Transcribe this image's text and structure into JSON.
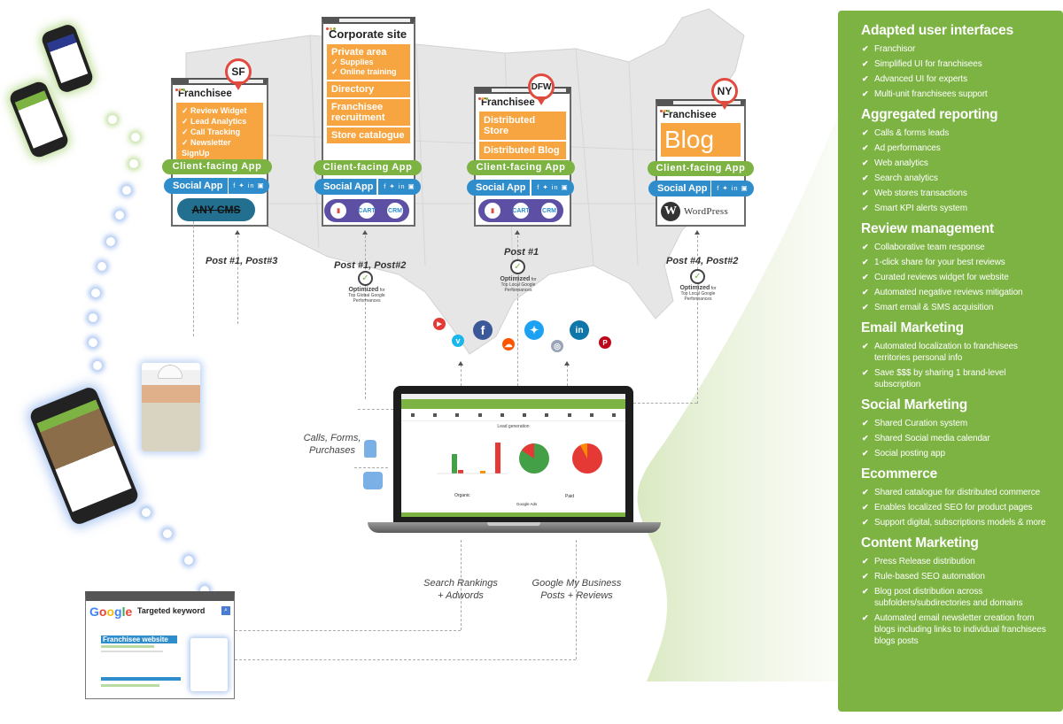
{
  "sites": {
    "sf": {
      "pin": "SF",
      "title": "Franchisee",
      "features": [
        "Review Widget",
        "Lead Analytics",
        "Call Tracking",
        "Newsletter SignUp"
      ],
      "client_app": "Client-facing App",
      "social_app": "Social App",
      "social_icons": "f ✦ in ▣",
      "cms": "ANY CMS",
      "posts": "Post #1, Post#3"
    },
    "corporate": {
      "title": "Corporate site",
      "private_area": "Private area",
      "private_items": [
        "Supplies",
        "Online training"
      ],
      "sections": [
        "Directory",
        "Franchisee recruitment",
        "Store catalogue"
      ],
      "client_app": "Client-facing App",
      "social_app": "Social App",
      "social_icons": "f ✦ in ▣",
      "apps": [
        "store-icon",
        "CART",
        "CRM"
      ],
      "posts": "Post #1, Post#2",
      "optimized": "Optimized",
      "optimized_for": "for",
      "optimized_desc": "Top Global Google Performances"
    },
    "dfw": {
      "pin": "DFW",
      "title": "Franchisee",
      "sections": [
        "Distributed Store",
        "Distributed Blog"
      ],
      "client_app": "Client-facing App",
      "social_app": "Social App",
      "social_icons": "f ✦ in ▣",
      "apps": [
        "store-icon",
        "CART",
        "CRM"
      ],
      "posts": "Post #1",
      "optimized": "Optimized",
      "optimized_for": "for",
      "optimized_desc": "Top Local Google Performances"
    },
    "ny": {
      "pin": "NY",
      "title": "Franchisee",
      "blog": "Blog",
      "client_app": "Client-facing App",
      "social_app": "Social App",
      "social_icons": "f ✦ in ▣",
      "cms": "WordPress",
      "posts": "Post #4, Post#2",
      "optimized": "Optimized",
      "optimized_for": "for",
      "optimized_desc": "Top Local Google Performances"
    }
  },
  "social_networks": [
    {
      "name": "youtube",
      "glyph": "▶",
      "color": "#e53935"
    },
    {
      "name": "vimeo",
      "glyph": "v",
      "color": "#1ab7ea"
    },
    {
      "name": "facebook",
      "glyph": "f",
      "color": "#3b5998"
    },
    {
      "name": "soundcloud",
      "glyph": "☁",
      "color": "#ff5500"
    },
    {
      "name": "twitter",
      "glyph": "✦",
      "color": "#1da1f2"
    },
    {
      "name": "instagram",
      "glyph": "◎",
      "color": "#9aa4b8"
    },
    {
      "name": "linkedin",
      "glyph": "in",
      "color": "#0e76a8"
    },
    {
      "name": "pinterest",
      "glyph": "P",
      "color": "#bd081c"
    }
  ],
  "flows": {
    "calls": "Calls, Forms, Purchases",
    "search": "Search Rankings + Adwords",
    "gmb": "Google My Business Posts + Reviews"
  },
  "dashboard": {
    "title": "Lead generation",
    "organic": "Organic",
    "paid": "Paid",
    "google_ads": "Google Ads"
  },
  "google_search": {
    "logo": "Google",
    "keyword": "Targeted keyword",
    "result": "Franchisee website"
  },
  "panel": {
    "sections": [
      {
        "title": "Adapted user interfaces",
        "items": [
          "Franchisor",
          "Simplified UI for franchisees",
          "Advanced UI for experts",
          "Multi-unit franchisees support"
        ]
      },
      {
        "title": "Aggregated reporting",
        "items": [
          "Calls & forms leads",
          "Ad performances",
          "Web analytics",
          "Search analytics",
          "Web stores transactions",
          "Smart KPI alerts system"
        ]
      },
      {
        "title": "Review management",
        "items": [
          "Collaborative team response",
          "1-click share for your best reviews",
          "Curated reviews widget for website",
          "Automated negative reviews mitigation",
          "Smart email & SMS acquisition"
        ]
      },
      {
        "title": "Email Marketing",
        "items": [
          "Automated localization to franchisees territories personal info",
          "Save $$$ by sharing 1 brand-level subscription"
        ]
      },
      {
        "title": "Social Marketing",
        "items": [
          "Shared Curation system",
          "Shared Social media calendar",
          "Social posting app"
        ]
      },
      {
        "title": "Ecommerce",
        "items": [
          "Shared catalogue for distributed commerce",
          "Enables localized SEO for product pages",
          "Support digital, subscriptions models & more"
        ]
      },
      {
        "title": "Content Marketing",
        "items": [
          "Press Release distribution",
          "Rule-based SEO automation",
          "Blog post distribution across subfolders/subdirectories and domains",
          "Automated email newsletter creation from blogs including links to individual franchisees blogs posts"
        ]
      }
    ],
    "check": "✔"
  },
  "colors": {
    "green": "#7cb342",
    "orange": "#f7a541",
    "blue": "#2f8dcc",
    "pin_red": "#e04a3f",
    "purple": "#5d4fa3"
  }
}
